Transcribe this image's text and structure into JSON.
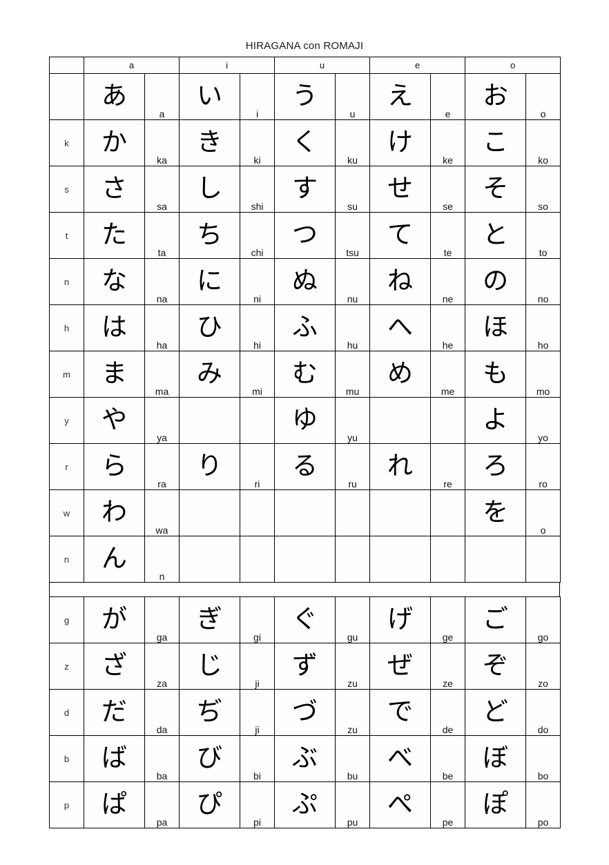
{
  "title": "HIRAGANA con ROMAJI",
  "columns": {
    "row_label_header": "",
    "vowels": [
      "a",
      "i",
      "u",
      "e",
      "o"
    ]
  },
  "tables": [
    {
      "name": "gojuon",
      "rows": [
        {
          "label": "",
          "cells": [
            {
              "kana": "あ",
              "romaji": "a"
            },
            {
              "kana": "い",
              "romaji": "i"
            },
            {
              "kana": "う",
              "romaji": "u"
            },
            {
              "kana": "え",
              "romaji": "e"
            },
            {
              "kana": "お",
              "romaji": "o"
            }
          ]
        },
        {
          "label": "k",
          "cells": [
            {
              "kana": "か",
              "romaji": "ka"
            },
            {
              "kana": "き",
              "romaji": "ki"
            },
            {
              "kana": "く",
              "romaji": "ku"
            },
            {
              "kana": "け",
              "romaji": "ke"
            },
            {
              "kana": "こ",
              "romaji": "ko"
            }
          ]
        },
        {
          "label": "s",
          "cells": [
            {
              "kana": "さ",
              "romaji": "sa"
            },
            {
              "kana": "し",
              "romaji": "shi"
            },
            {
              "kana": "す",
              "romaji": "su"
            },
            {
              "kana": "せ",
              "romaji": "se"
            },
            {
              "kana": "そ",
              "romaji": "so"
            }
          ]
        },
        {
          "label": "t",
          "cells": [
            {
              "kana": "た",
              "romaji": "ta"
            },
            {
              "kana": "ち",
              "romaji": "chi"
            },
            {
              "kana": "つ",
              "romaji": "tsu"
            },
            {
              "kana": "て",
              "romaji": "te"
            },
            {
              "kana": "と",
              "romaji": "to"
            }
          ]
        },
        {
          "label": "n",
          "cells": [
            {
              "kana": "な",
              "romaji": "na"
            },
            {
              "kana": "に",
              "romaji": "ni"
            },
            {
              "kana": "ぬ",
              "romaji": "nu"
            },
            {
              "kana": "ね",
              "romaji": "ne"
            },
            {
              "kana": "の",
              "romaji": "no"
            }
          ]
        },
        {
          "label": "h",
          "cells": [
            {
              "kana": "は",
              "romaji": "ha"
            },
            {
              "kana": "ひ",
              "romaji": "hi"
            },
            {
              "kana": "ふ",
              "romaji": "hu"
            },
            {
              "kana": "へ",
              "romaji": "he"
            },
            {
              "kana": "ほ",
              "romaji": "ho"
            }
          ]
        },
        {
          "label": "m",
          "cells": [
            {
              "kana": "ま",
              "romaji": "ma"
            },
            {
              "kana": "み",
              "romaji": "mi"
            },
            {
              "kana": "む",
              "romaji": "mu"
            },
            {
              "kana": "め",
              "romaji": "me"
            },
            {
              "kana": "も",
              "romaji": "mo"
            }
          ]
        },
        {
          "label": "y",
          "cells": [
            {
              "kana": "や",
              "romaji": "ya"
            },
            {
              "kana": "",
              "romaji": ""
            },
            {
              "kana": "ゆ",
              "romaji": "yu"
            },
            {
              "kana": "",
              "romaji": ""
            },
            {
              "kana": "よ",
              "romaji": "yo"
            }
          ]
        },
        {
          "label": "r",
          "cells": [
            {
              "kana": "ら",
              "romaji": "ra"
            },
            {
              "kana": "り",
              "romaji": "ri"
            },
            {
              "kana": "る",
              "romaji": "ru"
            },
            {
              "kana": "れ",
              "romaji": "re"
            },
            {
              "kana": "ろ",
              "romaji": "ro"
            }
          ]
        },
        {
          "label": "w",
          "cells": [
            {
              "kana": "わ",
              "romaji": "wa"
            },
            {
              "kana": "",
              "romaji": ""
            },
            {
              "kana": "",
              "romaji": ""
            },
            {
              "kana": "",
              "romaji": ""
            },
            {
              "kana": "を",
              "romaji": "o"
            }
          ]
        },
        {
          "label": "n",
          "cells": [
            {
              "kana": "ん",
              "romaji": "n"
            },
            {
              "kana": "",
              "romaji": ""
            },
            {
              "kana": "",
              "romaji": ""
            },
            {
              "kana": "",
              "romaji": ""
            },
            {
              "kana": "",
              "romaji": ""
            }
          ]
        }
      ]
    },
    {
      "name": "dakuten-handakuten",
      "rows": [
        {
          "label": "g",
          "cells": [
            {
              "kana": "が",
              "romaji": "ga"
            },
            {
              "kana": "ぎ",
              "romaji": "gi"
            },
            {
              "kana": "ぐ",
              "romaji": "gu"
            },
            {
              "kana": "げ",
              "romaji": "ge"
            },
            {
              "kana": "ご",
              "romaji": "go"
            }
          ]
        },
        {
          "label": "z",
          "cells": [
            {
              "kana": "ざ",
              "romaji": "za"
            },
            {
              "kana": "じ",
              "romaji": "ji"
            },
            {
              "kana": "ず",
              "romaji": "zu"
            },
            {
              "kana": "ぜ",
              "romaji": "ze"
            },
            {
              "kana": "ぞ",
              "romaji": "zo"
            }
          ]
        },
        {
          "label": "d",
          "cells": [
            {
              "kana": "だ",
              "romaji": "da"
            },
            {
              "kana": "ぢ",
              "romaji": "ji"
            },
            {
              "kana": "づ",
              "romaji": "zu"
            },
            {
              "kana": "で",
              "romaji": "de"
            },
            {
              "kana": "ど",
              "romaji": "do"
            }
          ]
        },
        {
          "label": "b",
          "cells": [
            {
              "kana": "ば",
              "romaji": "ba"
            },
            {
              "kana": "び",
              "romaji": "bi"
            },
            {
              "kana": "ぶ",
              "romaji": "bu"
            },
            {
              "kana": "べ",
              "romaji": "be"
            },
            {
              "kana": "ぼ",
              "romaji": "bo"
            }
          ]
        },
        {
          "label": "p",
          "cells": [
            {
              "kana": "ぱ",
              "romaji": "pa"
            },
            {
              "kana": "ぴ",
              "romaji": "pi"
            },
            {
              "kana": "ぷ",
              "romaji": "pu"
            },
            {
              "kana": "ぺ",
              "romaji": "pe"
            },
            {
              "kana": "ぽ",
              "romaji": "po"
            }
          ]
        }
      ]
    }
  ]
}
